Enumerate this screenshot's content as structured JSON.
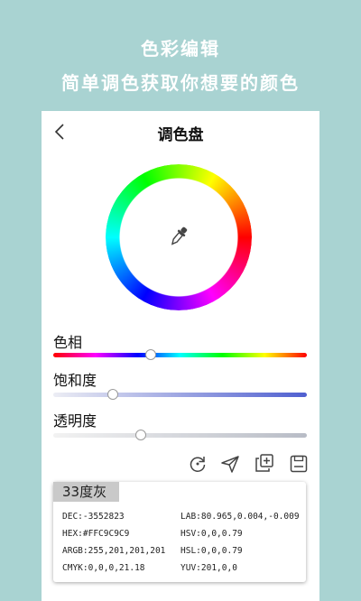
{
  "promo": {
    "title": "色彩编辑",
    "subtitle": "简单调色获取你想要的颜色"
  },
  "header": {
    "title": "调色盘",
    "back_icon": "chevron-left-icon"
  },
  "wheel": {
    "center_icon": "eyedropper-icon"
  },
  "sliders": {
    "hue": {
      "label": "色相",
      "value": 0.38
    },
    "saturation": {
      "label": "饱和度",
      "value": 0.23
    },
    "transparency": {
      "label": "透明度",
      "value": 0.34
    }
  },
  "toolbar": {
    "icons": [
      "refresh-icon",
      "send-icon",
      "add-copy-icon",
      "save-icon"
    ]
  },
  "color_info": {
    "name": "33度灰",
    "dec": "DEC:-3552823",
    "hex": "HEX:#FFC9C9C9",
    "argb": "ARGB:255,201,201,201",
    "cmyk": "CMYK:0,0,0,21.18",
    "lab": "LAB:80.965,0.004,-0.009",
    "hsv": "HSV:0,0,0.79",
    "hsl": "HSL:0,0,0.79",
    "yuv": "YUV:201,0,0"
  },
  "colors": {
    "background": "#a9d3d2",
    "card": "#ffffff",
    "saturation_end": "#4f5fd0",
    "swatch_bg": "#c9c9c9"
  }
}
